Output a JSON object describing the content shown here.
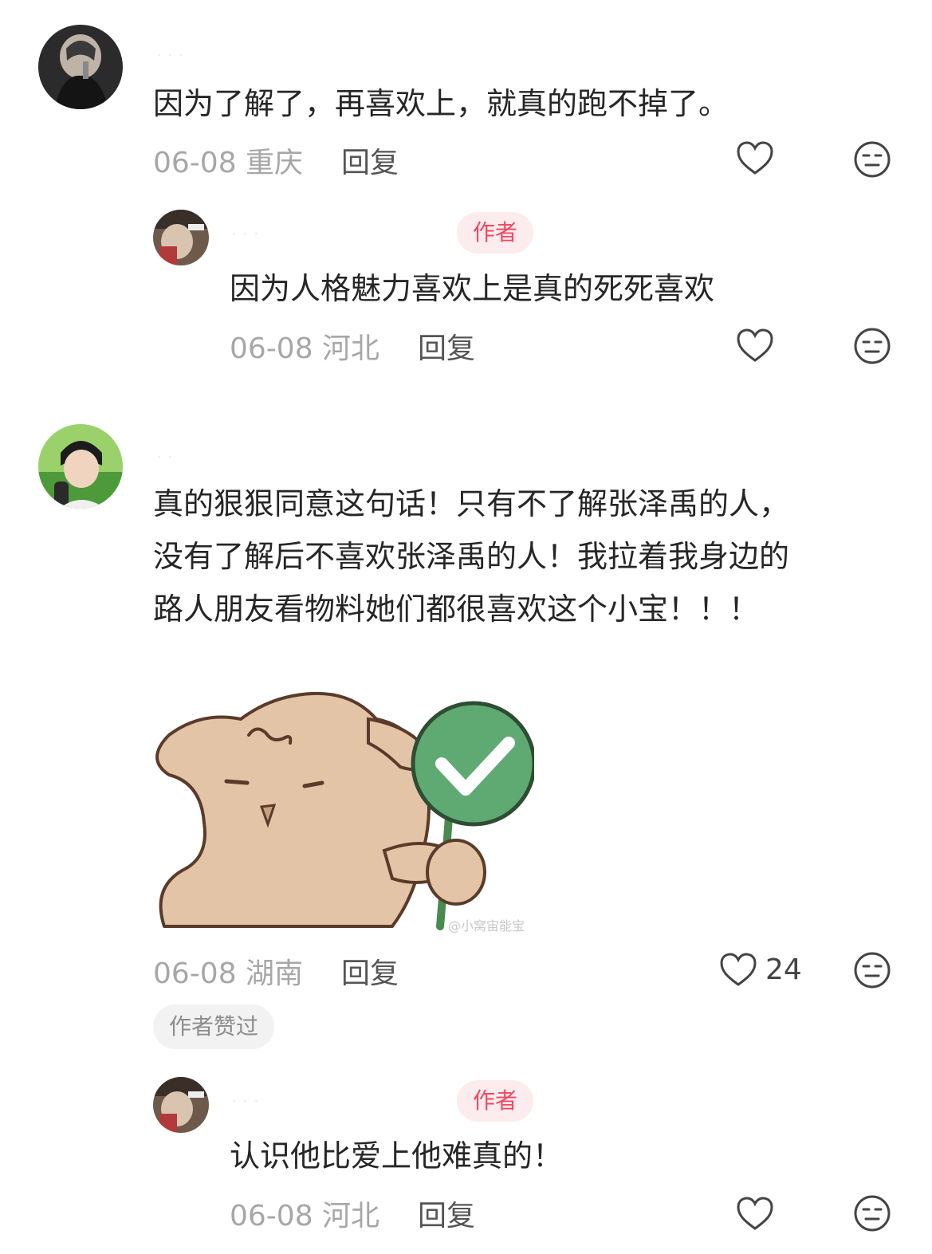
{
  "comments": [
    {
      "text": "因为了解了，再喜欢上，就真的跑不掉了。",
      "meta": "06-08 重庆",
      "reply_label": "回复",
      "reply": {
        "author_tag": "作者",
        "text": "因为人格魅力喜欢上是真的死死喜欢",
        "meta": "06-08 河北",
        "reply_label": "回复"
      }
    },
    {
      "text_lines": [
        "真的狠狠同意这句话！只有不了解张泽禹的人，",
        "没有了解后不喜欢张泽禹的人！我拉着我身边的",
        "路人朋友看物料她们都很喜欢这个小宝！！！"
      ],
      "sticker_watermark": "@小窝宙能宝",
      "meta": "06-08 湖南",
      "reply_label": "回复",
      "like_count": "24",
      "author_liked_label": "作者赞过",
      "reply": {
        "author_tag": "作者",
        "text": "认识他比爱上他难真的！",
        "meta": "06-08 河北",
        "reply_label": "回复"
      }
    }
  ],
  "icons": {
    "like": "heart-outline-icon",
    "dislike": "neutral-face-icon"
  },
  "colors": {
    "author_tag_bg": "#fdecee",
    "author_tag_text": "#f2475f",
    "sticker_green": "#5faa72",
    "sticker_body": "#e3c4a6"
  }
}
